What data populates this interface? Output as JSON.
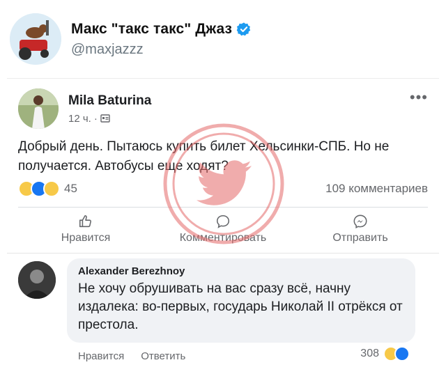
{
  "tweet": {
    "display_name": "Макс \"такс такс\" Джаз",
    "handle": "@maxjazzz",
    "verified": true
  },
  "post": {
    "author": "Mila Baturina",
    "time": "12 ч.",
    "separator": "·",
    "text": "Добрый день. Пытаюсь купить билет Хельсинки-СПБ. Но не получается. Автобусы еще ходят?",
    "reaction_count": "45",
    "comments_count": "109 комментариев",
    "actions": {
      "like": "Нравится",
      "comment": "Комментировать",
      "share": "Отправить"
    }
  },
  "comment": {
    "author": "Alexander Berezhnoy",
    "text": "Не хочу обрушивать на вас сразу всё, начну издалека: во-первых, государь Николай II отрёкся от престола.",
    "like": "Нравится",
    "reply": "Ответить",
    "reaction_count": "308"
  },
  "colors": {
    "verified_blue": "#1d9bf0",
    "fb_like_blue": "#1877f2",
    "watermark_red": "#e56a6a"
  }
}
